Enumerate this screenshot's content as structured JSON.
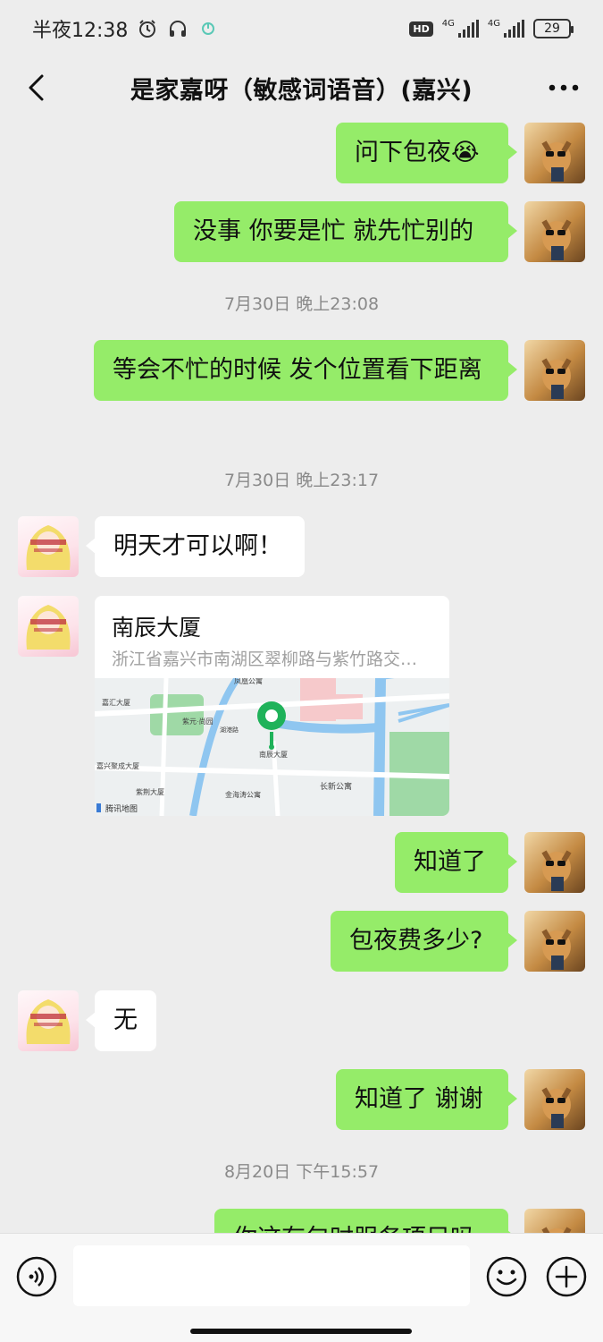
{
  "status_bar": {
    "time_label": "半夜12:38",
    "network_1": "4G",
    "network_2": "4G",
    "hd": "HD",
    "battery": "29"
  },
  "header": {
    "title": "是家嘉呀（敏感词语音）(嘉兴)"
  },
  "messages": [
    {
      "from": "me",
      "text": "问下包夜😭"
    },
    {
      "from": "me",
      "text": "没事 你要是忙 就先忙别的"
    },
    {
      "type": "timestamp",
      "text": "7月30日 晚上23:08"
    },
    {
      "from": "me",
      "text": "等会不忙的时候 发个位置看下距离"
    },
    {
      "type": "timestamp",
      "text": "7月30日 晚上23:17"
    },
    {
      "from": "them",
      "text": "明天才可以啊！"
    },
    {
      "from": "them",
      "type": "location",
      "name": "南辰大厦",
      "address": "浙江省嘉兴市南湖区翠柳路与紫竹路交…"
    },
    {
      "from": "me",
      "text": "知道了"
    },
    {
      "from": "me",
      "text": "包夜费多少?"
    },
    {
      "from": "them",
      "text": "无"
    },
    {
      "from": "me",
      "text": "知道了 谢谢"
    },
    {
      "type": "timestamp",
      "text": "8月20日 下午15:57"
    },
    {
      "from": "me",
      "text": "你这有包时服务项目吗"
    }
  ],
  "map": {
    "labels": {
      "jiahui": "嘉汇大厦",
      "ziyuan": "紫元·尚园",
      "jiaxing_jucheng": "嘉兴聚成大厦",
      "zijing": "紫荆大厦",
      "jinhaitao": "金海涛公寓",
      "nanchen": "南辰大厦",
      "changxin": "长新公寓",
      "hugang": "湖港路",
      "watermark": "腾讯地图",
      "top": "凤凰公寓"
    },
    "colors": {
      "water": "#8fc6f0",
      "green": "#9fd9a6",
      "pink": "#f6c9cb",
      "road": "#ffffff",
      "ground": "#edf0f1",
      "pin": "#1fb25a"
    }
  },
  "input": {
    "placeholder": ""
  },
  "colors": {
    "my_bubble": "#95ec69",
    "their_bubble": "#ffffff",
    "background": "#ededed"
  }
}
